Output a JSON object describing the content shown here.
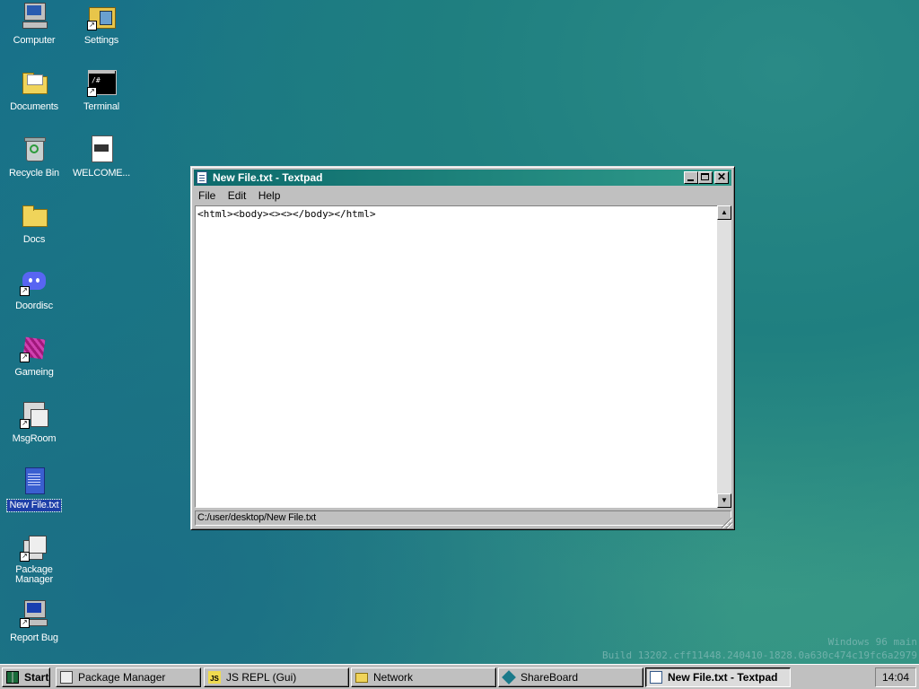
{
  "desktop": {
    "icons": [
      {
        "label": "Computer"
      },
      {
        "label": "Settings"
      },
      {
        "label": "Documents"
      },
      {
        "label": "Terminal"
      },
      {
        "label": "Recycle Bin"
      },
      {
        "label": "WELCOME..."
      },
      {
        "label": "Docs"
      },
      {
        "label": "Doordisc"
      },
      {
        "label": "Gameing"
      },
      {
        "label": "MsgRoom"
      },
      {
        "label": "New File.txt"
      },
      {
        "label": "Package Manager"
      },
      {
        "label": "Report Bug"
      }
    ],
    "watermark": {
      "line1": "Windows 96 main",
      "line2": "Build 13202.cff11448.240410-1828.0a630c474c19fc6a2979"
    }
  },
  "window": {
    "title": "New File.txt - Textpad",
    "menu": [
      "File",
      "Edit",
      "Help"
    ],
    "editor_text": "<html><body><><></body></html>",
    "status_path": "C:/user/desktop/New File.txt"
  },
  "taskbar": {
    "start_label": "Start",
    "buttons": [
      {
        "label": "Package Manager",
        "icon": "package-icon"
      },
      {
        "label": "JS REPL (Gui)",
        "icon": "js-icon"
      },
      {
        "label": "Network",
        "icon": "folder-icon"
      },
      {
        "label": "ShareBoard",
        "icon": "shareboard-icon"
      },
      {
        "label": "New File.txt - Textpad",
        "icon": "textpad-icon",
        "active": true
      }
    ],
    "clock": "14:04"
  }
}
